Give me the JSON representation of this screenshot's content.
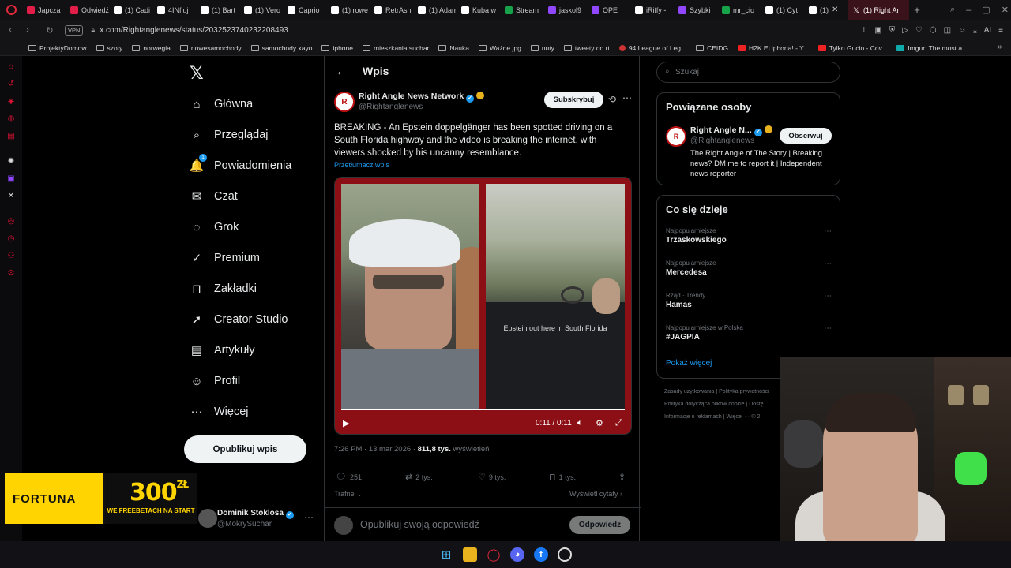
{
  "browser": {
    "tabs": [
      {
        "label": "Japcza",
        "color": "#e11d48"
      },
      {
        "label": "Odwiedź",
        "color": "#e11d48"
      },
      {
        "label": "(1) Cadi",
        "color": "#ffffff"
      },
      {
        "label": "4INfluj",
        "color": "#ffffff"
      },
      {
        "label": "(1) Bart",
        "color": "#ffffff"
      },
      {
        "label": "(1) Vero",
        "color": "#ffffff"
      },
      {
        "label": "Caprio",
        "color": "#ffffff"
      },
      {
        "label": "(1) rowe",
        "color": "#ffffff"
      },
      {
        "label": "RetrAsh",
        "color": "#ffffff"
      },
      {
        "label": "(1) Adam",
        "color": "#ffffff"
      },
      {
        "label": "Kuba w",
        "color": "#ffffff"
      },
      {
        "label": "Stream",
        "color": "#16a34a"
      },
      {
        "label": "jaskol9",
        "color": "#9146ff"
      },
      {
        "label": "OPE",
        "color": "#9146ff"
      },
      {
        "label": "iRiffy -",
        "color": "#ffffff"
      },
      {
        "label": "Szybki",
        "color": "#9146ff"
      },
      {
        "label": "mr_cio",
        "color": "#16a34a"
      },
      {
        "label": "(1) Cyt",
        "color": "#ffffff"
      },
      {
        "label": "(1)",
        "color": "#ffffff"
      }
    ],
    "active_tab": "(1) Right An",
    "url": "x.com/Rightanglenews/status/2032523740232208493",
    "vpn_label": "VPN",
    "ai_label": "AI",
    "bookmarks": [
      {
        "label": "ProjektyDomow",
        "icon": "folder"
      },
      {
        "label": "szoty",
        "icon": "folder"
      },
      {
        "label": "norwegia",
        "icon": "folder"
      },
      {
        "label": "nowesamochody",
        "icon": "folder"
      },
      {
        "label": "samochody xayo",
        "icon": "folder"
      },
      {
        "label": "iphone",
        "icon": "folder"
      },
      {
        "label": "mieszkania suchar",
        "icon": "folder"
      },
      {
        "label": "Nauka",
        "icon": "folder"
      },
      {
        "label": "Ważne jpg",
        "icon": "folder"
      },
      {
        "label": "nuty",
        "icon": "folder"
      },
      {
        "label": "tweety do rt",
        "icon": "folder"
      },
      {
        "label": "94 League of Leg...",
        "icon": "red"
      },
      {
        "label": "CEIDG",
        "icon": "folder"
      },
      {
        "label": "H2K EUphoria! - Y...",
        "icon": "yt"
      },
      {
        "label": "Tylko Gucio - Cov...",
        "icon": "yt"
      },
      {
        "label": "Imgur: The most a...",
        "icon": "img"
      }
    ]
  },
  "x_nav": {
    "items": [
      {
        "label": "Główna",
        "icon": "⌂",
        "name": "home"
      },
      {
        "label": "Przeglądaj",
        "icon": "⌕",
        "name": "explore"
      },
      {
        "label": "Powiadomienia",
        "icon": "🔔",
        "name": "notifications"
      },
      {
        "label": "Czat",
        "icon": "✉",
        "name": "chat"
      },
      {
        "label": "Grok",
        "icon": "◌",
        "name": "grok"
      },
      {
        "label": "Premium",
        "icon": "✓",
        "name": "premium"
      },
      {
        "label": "Zakładki",
        "icon": "⊓",
        "name": "bookmarks"
      },
      {
        "label": "Creator Studio",
        "icon": "➚",
        "name": "creator-studio"
      },
      {
        "label": "Artykuły",
        "icon": "▤",
        "name": "articles"
      },
      {
        "label": "Profil",
        "icon": "☺",
        "name": "profile"
      },
      {
        "label": "Więcej",
        "icon": "⋯",
        "name": "more"
      }
    ],
    "notifications_badge": "1",
    "post_button": "Opublikuj wpis",
    "account": {
      "name": "Dominik Stoklosa",
      "handle": "@MokrySuchar"
    }
  },
  "ad": {
    "brand": "FORTUNA",
    "amount": "300",
    "currency": "ZŁ",
    "promo": "WE FREEBETACH NA START"
  },
  "post": {
    "header": "Wpis",
    "author_name": "Right Angle News Network",
    "author_handle": "@Rightanglenews",
    "avatar_text": "R",
    "subscribe": "Subskrybuj",
    "text": "BREAKING - An Epstein doppelgänger has been spotted driving on a South Florida highway and the video is breaking the internet, with viewers shocked by his uncanny resemblance.",
    "translate": "Przetłumacz wpis",
    "video_caption": "Epstein out here in South Florida",
    "video_time": "0:11 / 0:11",
    "timestamp": "7:26 PM · 13 mar 2026 ·",
    "views_count": "811,8 tys.",
    "views_label": "wyświetleń",
    "replies": "251",
    "reposts": "2 tys.",
    "likes": "9 tys.",
    "bookmarks": "1 tys.",
    "sort": "Trafne",
    "quotes": "Wyświetl cytaty",
    "reply_placeholder": "Opublikuj swoją odpowiedź",
    "reply_button": "Odpowiedz"
  },
  "sidebar": {
    "search_placeholder": "Szukaj",
    "related_title": "Powiązane osoby",
    "related": {
      "name": "Right Angle N...",
      "handle": "@Rightanglenews",
      "avatar_text": "R",
      "follow": "Obserwuj",
      "bio": "The Right Angle of The Story | Breaking news? DM me to report it | Independent news reporter"
    },
    "trends_title": "Co się dzieje",
    "trends": [
      {
        "category": "Najpopularniejsze",
        "name": "Trzaskowskiego"
      },
      {
        "category": "Najpopularniejsze",
        "name": "Mercedesa"
      },
      {
        "category": "Rząd · Trendy",
        "name": "Hamas"
      },
      {
        "category": "Najpopularniejsze w Polska",
        "name": "#JAGPIA"
      }
    ],
    "show_more": "Pokaż więcej",
    "footer": [
      "Zasady użytkowania  |  Polityka prywatności",
      "Polityka dotycząca plików cookie  |  Dostę",
      "Informacje o reklamach  |  Więcej ···  © 2"
    ]
  }
}
